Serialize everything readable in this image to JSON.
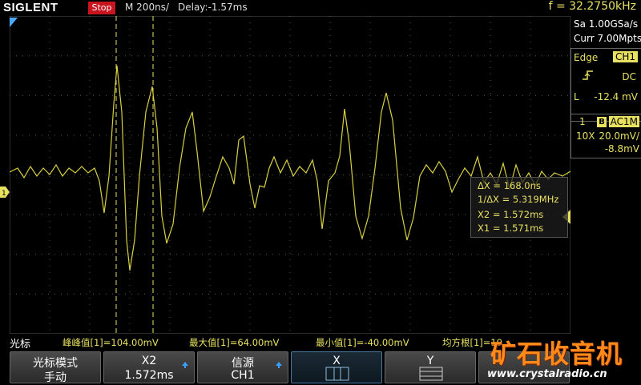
{
  "header": {
    "brand": "SIGLENT",
    "run_state": "Stop",
    "timebase": "M 200ns/",
    "delay": "Delay:-1.57ms",
    "frequency": "f = 32.2750kHz"
  },
  "side": {
    "sample_rate": "Sa 1.00GSa/s",
    "memory_depth": "Curr 7.00Mpts",
    "trigger": {
      "mode": "Edge",
      "source": "CH1",
      "slope_icon": "rising-edge-icon",
      "coupling": "DC",
      "level_label": "L",
      "level": "-12.4 mV"
    },
    "channel": {
      "number": "1",
      "bw_badge": "B",
      "coupling": "AC1M",
      "probe": "10X",
      "scale": "20.0mV/",
      "offset": "-8.8mV"
    }
  },
  "cursor_readout": {
    "delta_x": "ΔX = 168.0ns",
    "inv_delta_x": "1/ΔX = 5.319MHz",
    "x2": "X2 = 1.572ms",
    "x1": "X1 = 1.571ms"
  },
  "measure_bar": {
    "menu_title": "光标",
    "items": [
      "峰峰值[1]=104.00mV",
      "最大值[1]=64.00mV",
      "最小值[1]=-40.00mV",
      "均方根[1]=19"
    ]
  },
  "softkeys": [
    {
      "line1": "光标模式",
      "line2": "手动"
    },
    {
      "line1": "X2",
      "line2": "1.572ms"
    },
    {
      "line1": "信源",
      "line2": "CH1"
    },
    {
      "line1": "X",
      "line2": ""
    },
    {
      "line1": "Y",
      "line2": ""
    },
    {
      "line1": "",
      "line2": ""
    }
  ],
  "watermark": {
    "logo": "矿石收音机",
    "url": "www.crystalradio.cn"
  },
  "colors": {
    "trace": "#d8d040",
    "accent": "#e8e060",
    "stop": "#c8141e",
    "cursor_line": "#e8e060"
  }
}
